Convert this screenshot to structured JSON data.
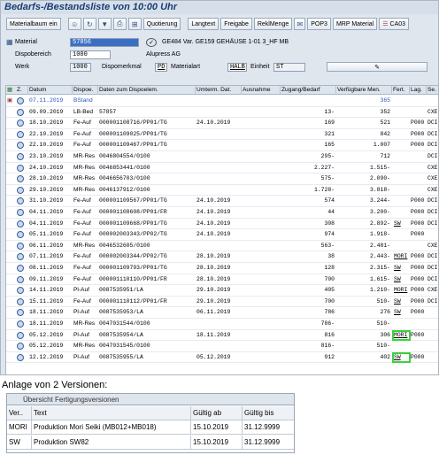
{
  "window": {
    "title": "Bedarfs-/Bestandsliste von 10:00 Uhr"
  },
  "toolbar": {
    "materialbaum_label": "Materialbaum ein",
    "quotierung_label": "Quotierung",
    "langtext_label": "Langtext",
    "freigabe_label": "Freigabe",
    "reklmenge_label": "ReklMenge",
    "pop3_label": "POP3",
    "mrp_material_label": "MRP Material",
    "ca03_label": "CA03"
  },
  "header": {
    "material_label": "Material",
    "material_value": "57856",
    "material_desc": "GE484 Var. GE159 GEHÄUSE 1-01 3_HF MB",
    "dispobereich_label": "Dispobereich",
    "dispobereich_value": "1000",
    "dispobereich_desc": "Alupress AG",
    "werk_label": "Werk",
    "werk_value": "1000",
    "dispomerkmal_label": "Dispomerkmal",
    "dispomerkmal_value": "PD",
    "materialart_label": "Materialart",
    "materialart_value": "HALB",
    "einheit_label": "Einheit",
    "einheit_value": "ST"
  },
  "grid": {
    "columns": [
      "Z.",
      "Datum",
      "Dispoe.",
      "Daten zum Dispoelem.",
      "Umterm. Dat.",
      "Ausnahme",
      "Zugang/Bedarf",
      "Verfügbare Men.",
      "Fert.",
      "Lag.",
      "Se."
    ],
    "rows": [
      {
        "datum": "07.11.2019",
        "dispo": "BStand",
        "daten": "",
        "umterm": "",
        "ausnahme": "",
        "zugang": "",
        "verfueg": "365",
        "fert": "",
        "lag": "",
        "se": ""
      },
      {
        "datum": "09.09.2019",
        "dispo": "LB-Bed",
        "daten": "57857",
        "umterm": "",
        "ausnahme": "",
        "zugang": "13-",
        "verfueg": "352",
        "fert": "",
        "lag": "",
        "se": "CXE"
      },
      {
        "datum": "18.10.2019",
        "dispo": "Fe-Auf",
        "daten": "000001108716/PP01/TG",
        "umterm": "24.10.2019",
        "ausnahme": "",
        "zugang": "169",
        "verfueg": "521",
        "fert": "",
        "lag": "P000",
        "se": "DCI"
      },
      {
        "datum": "22.10.2019",
        "dispo": "Fe-Auf",
        "daten": "000001109025/PP01/TG",
        "umterm": "",
        "ausnahme": "",
        "zugang": "321",
        "verfueg": "842",
        "fert": "",
        "lag": "P000",
        "se": "DCI"
      },
      {
        "datum": "22.10.2019",
        "dispo": "Fe-Auf",
        "daten": "000001109467/PP01/TG",
        "umterm": "",
        "ausnahme": "",
        "zugang": "165",
        "verfueg": "1.007",
        "fert": "",
        "lag": "P000",
        "se": "DCI"
      },
      {
        "datum": "23.10.2019",
        "dispo": "MR-Res",
        "daten": "0046804554/0100",
        "umterm": "",
        "ausnahme": "",
        "zugang": "295-",
        "verfueg": "712",
        "fert": "",
        "lag": "",
        "se": "DCI"
      },
      {
        "datum": "24.10.2019",
        "dispo": "MR-Res",
        "daten": "0046853441/0100",
        "umterm": "",
        "ausnahme": "",
        "zugang": "2.227-",
        "verfueg": "1.515-",
        "fert": "",
        "lag": "",
        "se": "CXE"
      },
      {
        "datum": "28.10.2019",
        "dispo": "MR-Res",
        "daten": "0046656703/0100",
        "umterm": "",
        "ausnahme": "",
        "zugang": "575-",
        "verfueg": "2.090-",
        "fert": "",
        "lag": "",
        "se": "CXE"
      },
      {
        "datum": "29.10.2019",
        "dispo": "MR-Res",
        "daten": "0046137912/0100",
        "umterm": "",
        "ausnahme": "",
        "zugang": "1.728-",
        "verfueg": "3.818-",
        "fert": "",
        "lag": "",
        "se": "CXE"
      },
      {
        "datum": "31.10.2019",
        "dispo": "Fe-Auf",
        "daten": "000001109567/PP01/TG",
        "umterm": "24.10.2019",
        "ausnahme": "",
        "zugang": "574",
        "verfueg": "3.244-",
        "fert": "",
        "lag": "P000",
        "se": "DCI"
      },
      {
        "datum": "04.11.2019",
        "dispo": "Fe-Auf",
        "daten": "000001108608/PP01/FR",
        "umterm": "24.10.2019",
        "ausnahme": "",
        "zugang": "44",
        "verfueg": "3.200-",
        "fert": "",
        "lag": "P000",
        "se": "DCI"
      },
      {
        "datum": "04.11.2019",
        "dispo": "Fe-Auf",
        "daten": "000001109668/PP01/TG",
        "umterm": "24.10.2019",
        "ausnahme": "",
        "zugang": "308",
        "verfueg": "2.892-",
        "fert": "SW",
        "lag": "P000",
        "se": "DCI"
      },
      {
        "datum": "05.11.2019",
        "dispo": "Fe-Auf",
        "daten": "000002003343/PP02/TG",
        "umterm": "24.10.2019",
        "ausnahme": "",
        "zugang": "974",
        "verfueg": "1.918-",
        "fert": "",
        "lag": "P000",
        "se": ""
      },
      {
        "datum": "06.11.2019",
        "dispo": "MR-Res",
        "daten": "0046532605/0100",
        "umterm": "",
        "ausnahme": "",
        "zugang": "563-",
        "verfueg": "2.481-",
        "fert": "",
        "lag": "",
        "se": "CXE"
      },
      {
        "datum": "07.11.2019",
        "dispo": "Fe-Auf",
        "daten": "000002003344/PP02/TG",
        "umterm": "28.10.2019",
        "ausnahme": "",
        "zugang": "38",
        "verfueg": "2.443-",
        "fert": "MORI",
        "lag": "P000",
        "se": "DCI"
      },
      {
        "datum": "08.11.2019",
        "dispo": "Fe-Auf",
        "daten": "000001109793/PP01/TG",
        "umterm": "28.10.2019",
        "ausnahme": "",
        "zugang": "128",
        "verfueg": "2.315-",
        "fert": "SW",
        "lag": "P000",
        "se": "DCI"
      },
      {
        "datum": "09.11.2019",
        "dispo": "Fe-Auf",
        "daten": "000001110110/PP01/FR",
        "umterm": "28.10.2019",
        "ausnahme": "",
        "zugang": "700",
        "verfueg": "1.615-",
        "fert": "SW",
        "lag": "P000",
        "se": "DCI"
      },
      {
        "datum": "14.11.2019",
        "dispo": "Pl-Auf",
        "daten": "0087535951/LA",
        "umterm": "29.10.2019",
        "ausnahme": "",
        "zugang": "405",
        "verfueg": "1.210-",
        "fert": "MORI",
        "lag": "P000",
        "se": "CXE"
      },
      {
        "datum": "15.11.2019",
        "dispo": "Fe-Auf",
        "daten": "000001110112/PP01/FR",
        "umterm": "29.10.2019",
        "ausnahme": "",
        "zugang": "700",
        "verfueg": "510-",
        "fert": "SW",
        "lag": "P000",
        "se": "DCI"
      },
      {
        "datum": "18.11.2019",
        "dispo": "Pl-Auf",
        "daten": "0087535953/LA",
        "umterm": "06.11.2019",
        "ausnahme": "",
        "zugang": "786",
        "verfueg": "276",
        "fert": "SW",
        "lag": "P000",
        "se": ""
      },
      {
        "datum": "18.11.2019",
        "dispo": "MR-Res",
        "daten": "0047031544/0100",
        "umterm": "",
        "ausnahme": "",
        "zugang": "786-",
        "verfueg": "510-",
        "fert": "",
        "lag": "",
        "se": ""
      },
      {
        "datum": "05.12.2019",
        "dispo": "Pl-Auf",
        "daten": "0087535954/LA",
        "umterm": "18.11.2019",
        "ausnahme": "",
        "zugang": "816",
        "verfueg": "306",
        "fert": "MORI",
        "lag": "P000",
        "se": ""
      },
      {
        "datum": "05.12.2019",
        "dispo": "MR-Res",
        "daten": "0047031545/0100",
        "umterm": "",
        "ausnahme": "",
        "zugang": "816-",
        "verfueg": "510-",
        "fert": "",
        "lag": "",
        "se": ""
      },
      {
        "datum": "12.12.2019",
        "dispo": "Pl-Auf",
        "daten": "0087535955/LA",
        "umterm": "05.12.2019",
        "ausnahme": "",
        "zugang": "912",
        "verfueg": "402",
        "fert": "SW",
        "lag": "P000",
        "se": ""
      }
    ]
  },
  "caption": "Anlage von 2 Versionen:",
  "versions_panel": {
    "title": "Übersicht Fertigungsversionen",
    "columns": [
      "Ver..",
      "Text",
      "Gültig ab",
      "Gültig bis"
    ],
    "rows": [
      {
        "ver": "MORI",
        "text": "Produktion Mori Seiki (MB012+MB018)",
        "ab": "15.10.2019",
        "bis": "31.12.9999"
      },
      {
        "ver": "SW",
        "text": "Produktion SW82",
        "ab": "15.10.2019",
        "bis": "31.12.9999"
      }
    ]
  },
  "colors": {
    "title_blue": "#1a3d72",
    "highlight_green": "#3cd13c",
    "selection_blue": "#3b6fc4",
    "header_grey": "#dce4ee"
  }
}
